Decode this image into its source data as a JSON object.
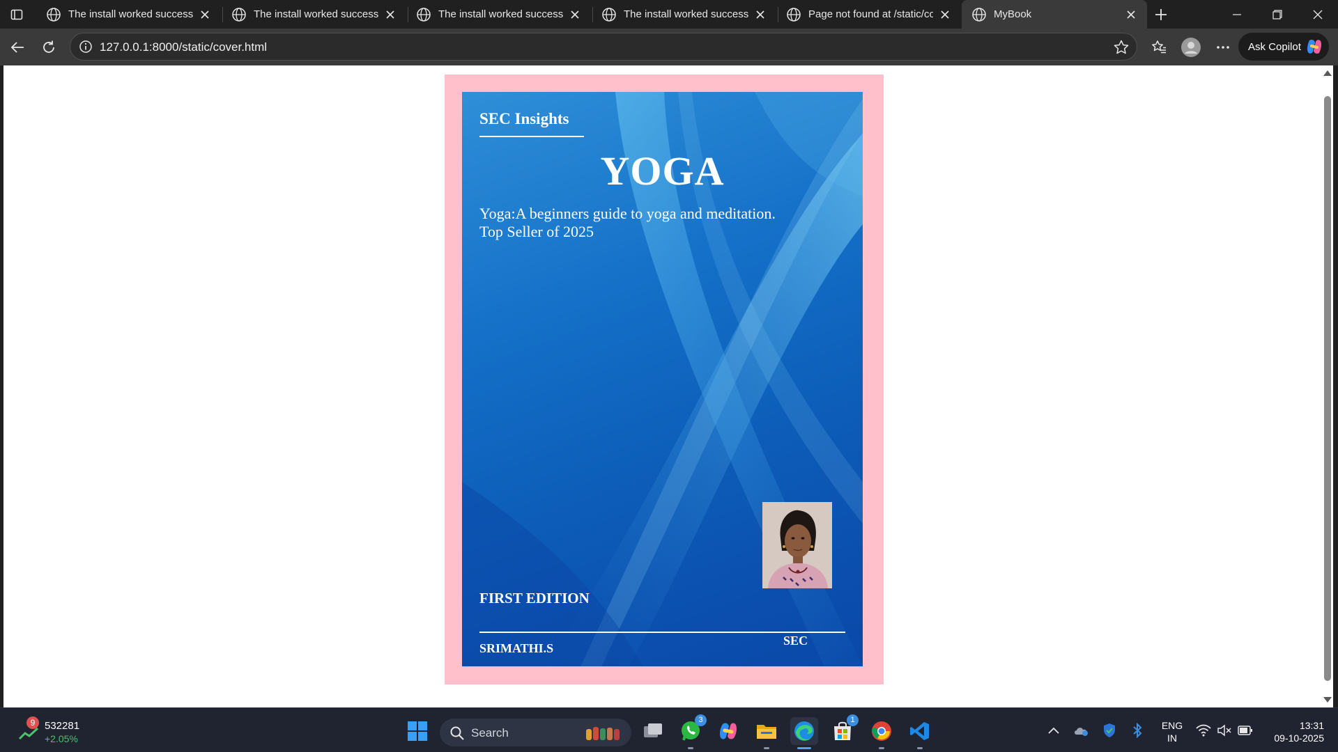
{
  "browser": {
    "tabs": [
      {
        "title": "The install worked successfully!",
        "active": false
      },
      {
        "title": "The install worked successfully!",
        "active": false
      },
      {
        "title": "The install worked successfully!",
        "active": false
      },
      {
        "title": "The install worked successfully!",
        "active": false
      },
      {
        "title": "Page not found at /static/cover.html",
        "active": false
      },
      {
        "title": "MyBook",
        "active": true
      }
    ],
    "url": "127.0.0.1:8000/static/cover.html",
    "copilot_label": "Ask Copilot"
  },
  "cover": {
    "brand": "SEC Insights",
    "title": "YOGA",
    "subtitle_line1": "Yoga:A beginners guide to yoga and meditation.",
    "subtitle_line2": "Top Seller of 2025",
    "edition": "FIRST EDITION",
    "author": "SRIMATHI.S",
    "publisher": "SEC",
    "frame_color": "#ffc0cb",
    "cover_color": "#0d5fba"
  },
  "taskbar": {
    "stock_badge": "9",
    "stock_value": "532281",
    "stock_change": "+2.05%",
    "search_label": "Search",
    "whatsapp_badge": "3",
    "store_badge": "1",
    "lang_line1": "ENG",
    "lang_line2": "IN",
    "time": "13:31",
    "date": "09-10-2025"
  }
}
